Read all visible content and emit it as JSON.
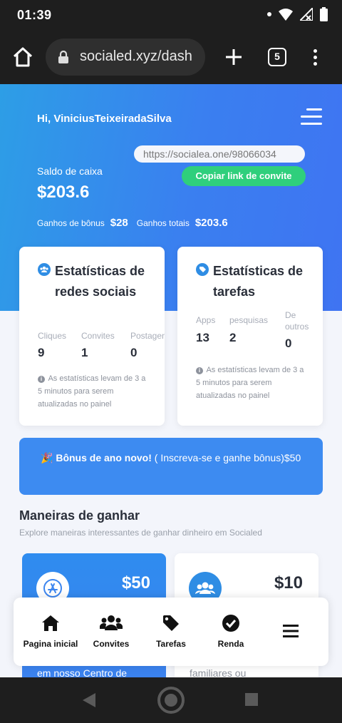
{
  "status_bar": {
    "time": "01:39"
  },
  "browser": {
    "url": "socialed.xyz/dash",
    "tab_count": "5"
  },
  "header": {
    "greeting": "Hi, ViniciusTeixeiradaSilva",
    "invite_url": "https://socialea.one/98066034",
    "copy_button": "Copiar link de convite",
    "balance_label": "Saldo de caixa",
    "balance": "$203.6",
    "bonus_label": "Ganhos de bônus",
    "bonus_value": "$28",
    "total_label": "Ganhos totais",
    "total_value": "$203.6"
  },
  "social_stats": {
    "title": "Estatísticas de redes sociais",
    "items": [
      {
        "label": "Cliques",
        "value": "9"
      },
      {
        "label": "Convites",
        "value": "1"
      },
      {
        "label": "Postagens",
        "value": "0"
      }
    ],
    "note": "As estatísticas levam de 3 a 5 minutos para serem atualizadas no painel"
  },
  "task_stats": {
    "title": "Estatísticas de tarefas",
    "items": [
      {
        "label": "Apps",
        "value": "13"
      },
      {
        "label": "pesquisas",
        "value": "2"
      },
      {
        "label": "De outros",
        "value": "0"
      }
    ],
    "note": "As estatísticas levam de 3 a 5 minutos para serem atualizadas no painel"
  },
  "promo": {
    "emoji": "🎉",
    "bold": "Bônus de ano novo!",
    "rest": " ( Inscreva-se e ganhe bônus)$50"
  },
  "earn_section": {
    "title": "Maneiras de ganhar",
    "subtitle": "Explore maneiras interessantes de ganhar dinheiro em Socialed",
    "cards": [
      {
        "amount": "$50",
        "text": "em nosso Centro de"
      },
      {
        "amount": "$10",
        "text": "familiares ou"
      }
    ]
  },
  "bottom_nav": [
    {
      "label": "Pagina inicial",
      "icon": "home-icon"
    },
    {
      "label": "Convites",
      "icon": "users-icon"
    },
    {
      "label": "Tarefas",
      "icon": "tag-icon"
    },
    {
      "label": "Renda",
      "icon": "check-circle-icon"
    },
    {
      "label": "",
      "icon": "bars-icon"
    }
  ],
  "colors": {
    "hero_blue": "#3a7ff0",
    "accent_green": "#2fcf7c",
    "promo_blue": "#3d8bf1",
    "card_icon_blue": "#2f8de4"
  }
}
